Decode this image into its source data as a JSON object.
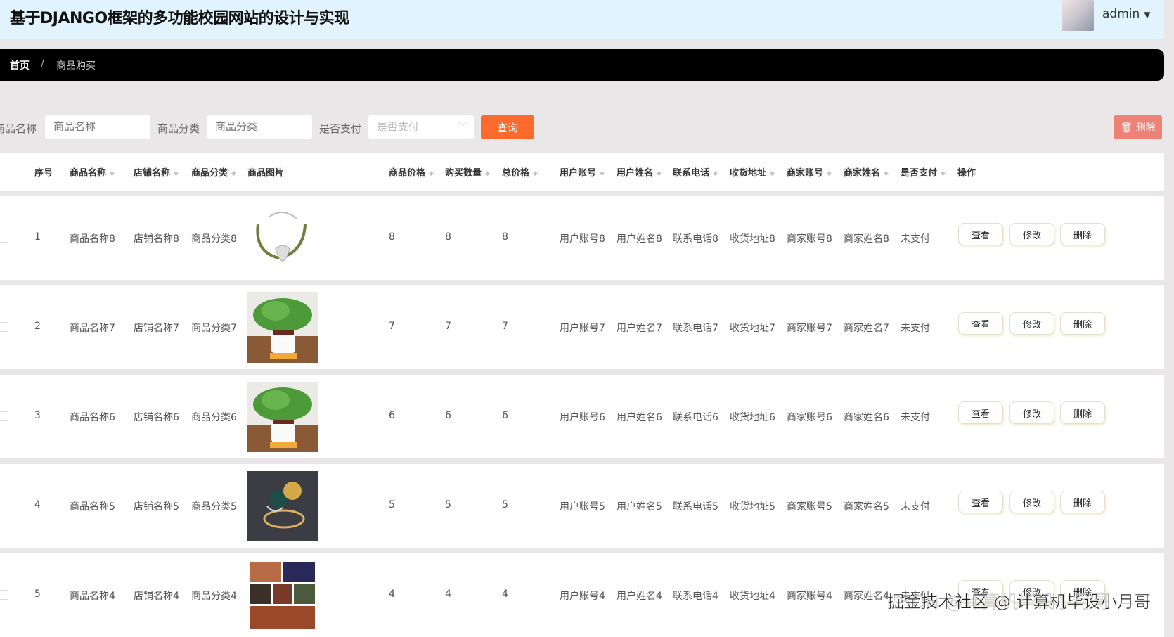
{
  "header": {
    "title": "基于DJANGO框架的多功能校园网站的设计与实现",
    "user": "admin",
    "caret": "▼"
  },
  "breadcrumb": {
    "home": "首页",
    "separator": "/",
    "current": "商品购买"
  },
  "filters": {
    "name_label": "商品名称",
    "name_placeholder": "商品名称",
    "category_label": "商品分类",
    "category_placeholder": "商品分类",
    "paid_label": "是否支付",
    "paid_placeholder": "是否支付",
    "search_button": "查询",
    "delete_button": "删除"
  },
  "table": {
    "columns": [
      "序号",
      "商品名称",
      "店铺名称",
      "商品分类",
      "商品图片",
      "商品价格",
      "购买数量",
      "总价格",
      "用户账号",
      "用户姓名",
      "联系电话",
      "收货地址",
      "商家账号",
      "商家姓名",
      "是否支付",
      "操作"
    ],
    "sortable": [
      false,
      true,
      true,
      true,
      false,
      true,
      true,
      true,
      true,
      true,
      true,
      true,
      true,
      true,
      true,
      false
    ],
    "actions": [
      "查看",
      "修改",
      "删除"
    ],
    "rows": [
      {
        "no": "1",
        "name": "商品名称8",
        "shop": "店铺名称8",
        "category": "商品分类8",
        "image": "bracelet",
        "price": "8",
        "qty": "8",
        "total": "8",
        "account": "用户账号8",
        "username": "用户姓名8",
        "phone": "联系电话8",
        "address": "收货地址8",
        "merchant_account": "商家账号8",
        "merchant_name": "商家姓名8",
        "paid": "未支付"
      },
      {
        "no": "2",
        "name": "商品名称7",
        "shop": "店铺名称7",
        "category": "商品分类7",
        "image": "plant",
        "price": "7",
        "qty": "7",
        "total": "7",
        "account": "用户账号7",
        "username": "用户姓名7",
        "phone": "联系电话7",
        "address": "收货地址7",
        "merchant_account": "商家账号7",
        "merchant_name": "商家姓名7",
        "paid": "未支付"
      },
      {
        "no": "3",
        "name": "商品名称6",
        "shop": "店铺名称6",
        "category": "商品分类6",
        "image": "plant",
        "price": "6",
        "qty": "6",
        "total": "6",
        "account": "用户账号6",
        "username": "用户姓名6",
        "phone": "联系电话6",
        "address": "收货地址6",
        "merchant_account": "商家账号6",
        "merchant_name": "商家姓名6",
        "paid": "未支付"
      },
      {
        "no": "4",
        "name": "商品名称5",
        "shop": "店铺名称5",
        "category": "商品分类5",
        "image": "ring",
        "price": "5",
        "qty": "5",
        "total": "5",
        "account": "用户账号5",
        "username": "用户姓名5",
        "phone": "联系电话5",
        "address": "收货地址5",
        "merchant_account": "商家账号5",
        "merchant_name": "商家姓名5",
        "paid": "未支付"
      },
      {
        "no": "5",
        "name": "商品名称4",
        "shop": "店铺名称4",
        "category": "商品分类4",
        "image": "collage",
        "price": "4",
        "qty": "4",
        "total": "4",
        "account": "用户账号4",
        "username": "用户姓名4",
        "phone": "联系电话4",
        "address": "收货地址4",
        "merchant_account": "商家账号4",
        "merchant_name": "商家姓名4",
        "paid": "未支付"
      }
    ]
  },
  "watermark": {
    "juejin": "掘金技术社区 @ 计算机毕设小月哥",
    "csdn": "CSDN @计算机毕设小月哥"
  }
}
